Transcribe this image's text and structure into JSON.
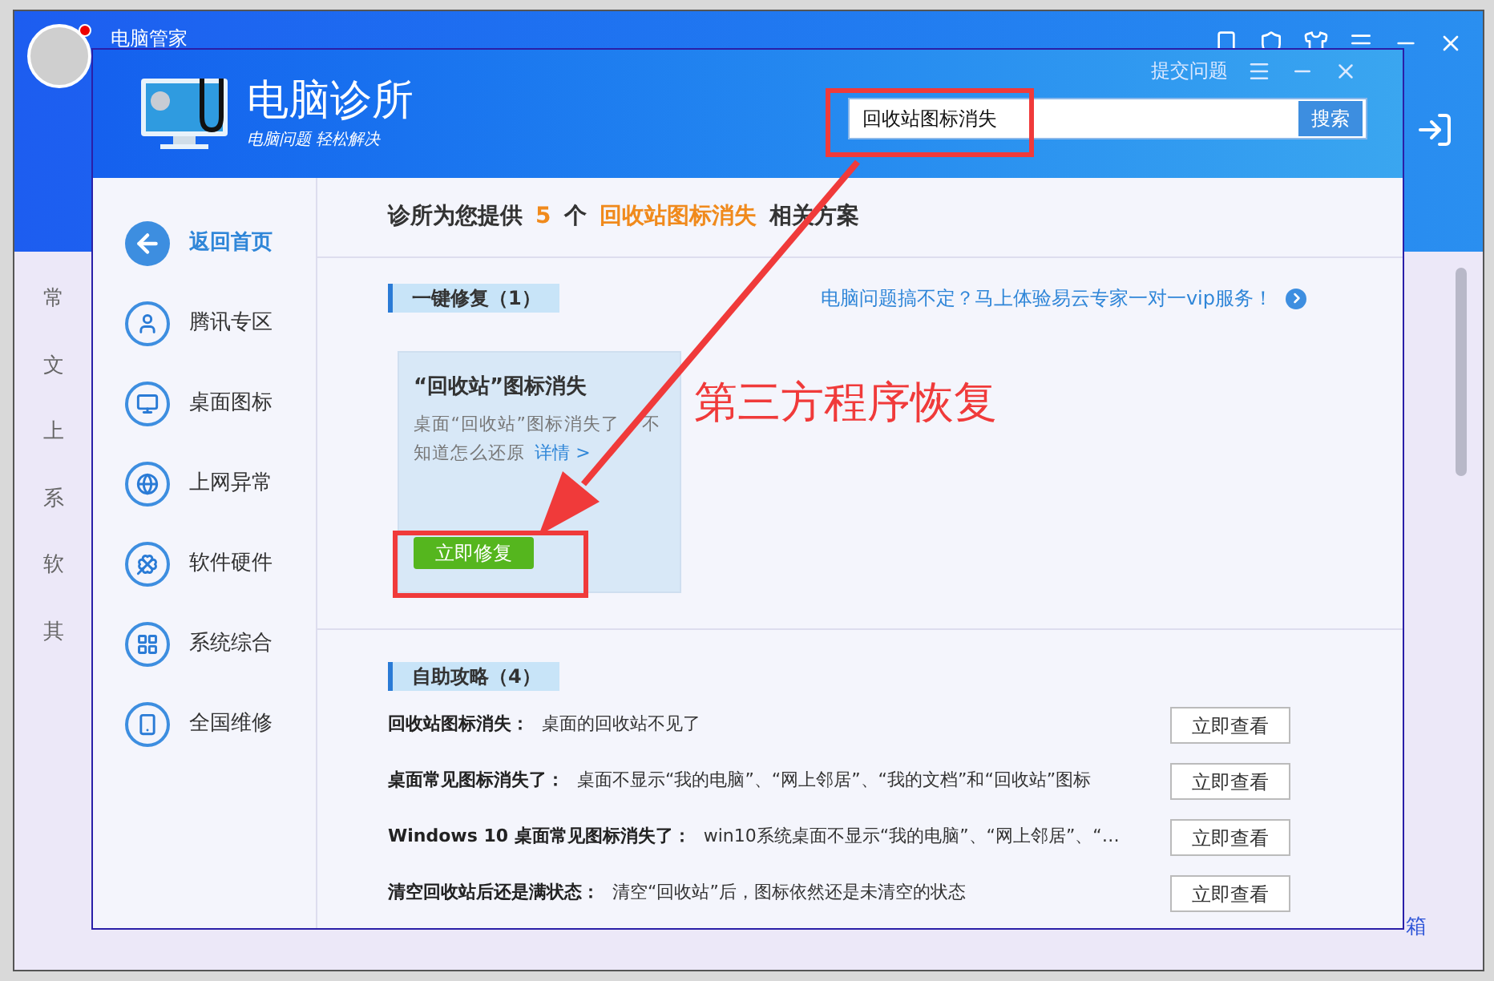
{
  "background_window": {
    "title": "电脑管家",
    "side_labels": [
      "常",
      "文",
      "上",
      "系",
      "软",
      "其"
    ],
    "corner_label": "箱"
  },
  "dialog": {
    "title": "电脑诊所",
    "slogan": "电脑问题 轻松解决",
    "submit_link": "提交问题",
    "search": {
      "value": "回收站图标消失",
      "button": "搜索"
    }
  },
  "sidebar": {
    "items": [
      {
        "label": "返回首页",
        "kind": "back"
      },
      {
        "label": "腾讯专区",
        "kind": "person"
      },
      {
        "label": "桌面图标",
        "kind": "monitor"
      },
      {
        "label": "上网异常",
        "kind": "browser"
      },
      {
        "label": "软件硬件",
        "kind": "clover"
      },
      {
        "label": "系统综合",
        "kind": "windows"
      },
      {
        "label": "全国维修",
        "kind": "device"
      }
    ]
  },
  "summary": {
    "prefix": "诊所为您提供",
    "count": "5",
    "unit": "个",
    "keyword": "回收站图标消失",
    "suffix": "相关方案"
  },
  "one_click": {
    "heading": "一键修复（1）",
    "promo_link": "电脑问题搞不定？马上体验易云专家一对一vip服务！",
    "card": {
      "title": "“回收站”图标消失",
      "description": "桌面“回收站”图标消失了 不知道怎么还原",
      "details_link": "详情 >",
      "button": "立即修复"
    }
  },
  "guides": {
    "heading": "自助攻略（4）",
    "rows": [
      {
        "title": "回收站图标消失：",
        "description": "桌面的回收站不见了",
        "button": "立即查看"
      },
      {
        "title": "桌面常见图标消失了：",
        "description": "桌面不显示“我的电脑”、“网上邻居”、“我的文档”和“回收站”图标",
        "button": "立即查看"
      },
      {
        "title": "Windows 10 桌面常见图标消失了：",
        "description": "win10系统桌面不显示“我的电脑”、“网上邻居”、“…",
        "button": "立即查看"
      },
      {
        "title": "清空回收站后还是满状态：",
        "description": "清空“回收站”后，图标依然还是未清空的状态",
        "button": "立即查看"
      }
    ]
  },
  "annotation": {
    "text": "第三方程序恢复"
  }
}
